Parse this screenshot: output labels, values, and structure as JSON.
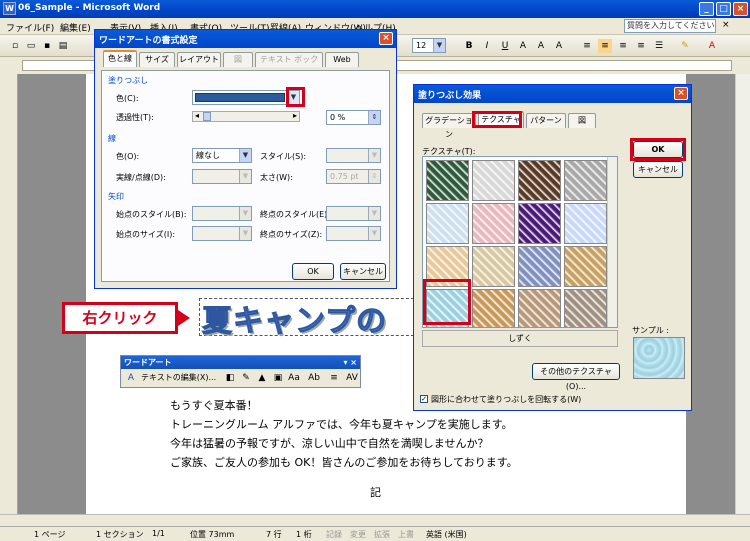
{
  "window": {
    "title": "06_Sample - Microsoft Word",
    "help_placeholder": "質問を入力してください",
    "font_size": "12",
    "menus": [
      "ファイル(F)",
      "編集(E)",
      "表示(V)",
      "挿入(I)",
      "書式(O)",
      "ツール(T)",
      "罫線(A)",
      "ウィンドウ(W)",
      "ヘルプ(H)"
    ]
  },
  "document": {
    "wordart_text": "夏キャンプの",
    "callout": "右クリック",
    "lines": [
      "もうすぐ夏本番！",
      "トレーニングルーム アルファでは、今年も夏キャンプを実施します。",
      "今年は猛暑の予報ですが、涼しい山中で自然を満喫しませんか？",
      "ご家族、ご友人の参加も OK！皆さんのご参加をお待ちしております。"
    ],
    "ki": "記"
  },
  "wordart_toolbar": {
    "title": "ワードアート",
    "edit_label": "テキストの編集(X)..."
  },
  "format_dialog": {
    "title": "ワードアートの書式設定",
    "tabs": [
      "色と線",
      "サイズ",
      "レイアウト",
      "図",
      "テキスト ボックス",
      "Web"
    ],
    "fill_group": "塗りつぶし",
    "color_label": "色(C):",
    "color_value": "#2b5c9e",
    "transparency_label": "透過性(T):",
    "transparency_value": "0 %",
    "line_group": "線",
    "line_color_label": "色(O):",
    "line_color_value": "線なし",
    "style_label": "スタイル(S):",
    "dash_label": "実線/点線(D):",
    "weight_label": "太さ(W):",
    "weight_value": "0.75 pt",
    "arrow_group": "矢印",
    "begin_style": "始点のスタイル(B):",
    "end_style": "終点のスタイル(E):",
    "begin_size": "始点のサイズ(I):",
    "end_size": "終点のサイズ(Z):",
    "ok": "OK",
    "cancel": "キャンセル"
  },
  "fill_dialog": {
    "title": "塗りつぶし効果",
    "tabs": [
      "グラデーション",
      "テクスチャ",
      "パターン",
      "図"
    ],
    "texture_label": "テクスチャ(T):",
    "selected_name": "しずく",
    "other_texture": "その他のテクスチャ(O)...",
    "rotate_checkbox": "図形に合わせて塗りつぶしを回転する(W)",
    "sample_label": "サンプル :",
    "ok": "OK",
    "cancel": "キャンセル",
    "textures": [
      "#2e5a3c",
      "#d8d8d8",
      "#5a3a24",
      "#a8a8a8",
      "#cce0f0",
      "#e8b8bc",
      "#4a1a78",
      "#c8d8f8",
      "#e8c898",
      "#d8c8a0",
      "#8090c0",
      "#c8a060",
      "#9ad0e0",
      "#c89858",
      "#b89878",
      "#a09080"
    ]
  },
  "statusbar": {
    "page": "1 ページ",
    "section": "1 セクション",
    "pages": "1/1",
    "position": "位置 73mm",
    "line": "7 行",
    "col": "1 桁",
    "rec": "記録",
    "trk": "変更",
    "ext": "拡張",
    "ovr": "上書",
    "lang": "英語 (米国)"
  }
}
